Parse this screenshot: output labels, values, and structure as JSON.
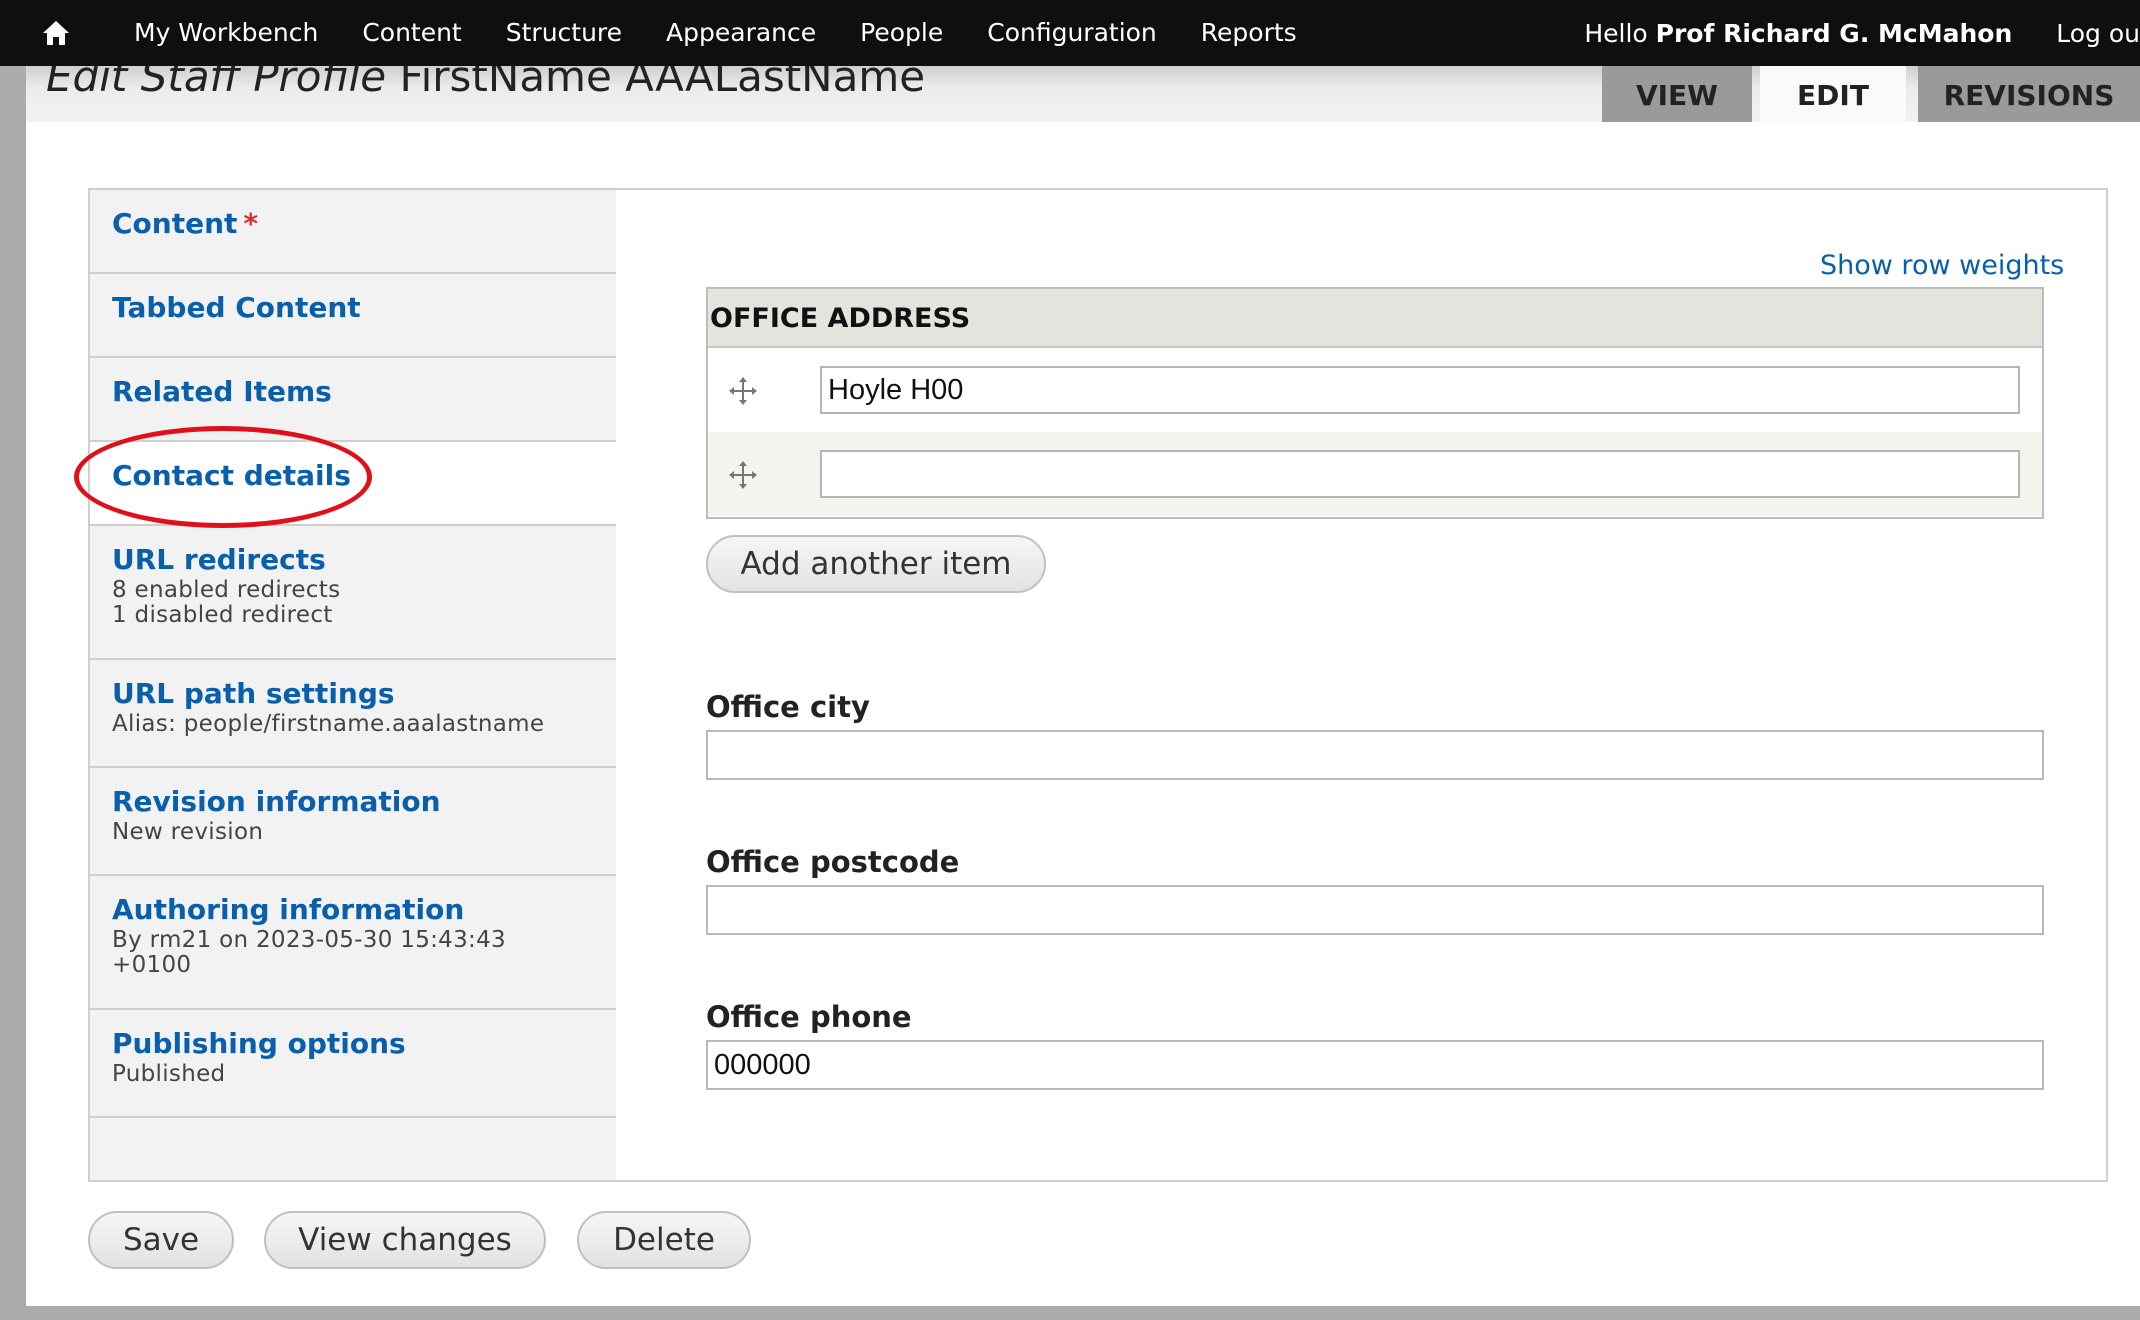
{
  "toolbar": {
    "home_icon": "home-icon",
    "items": [
      "My Workbench",
      "Content",
      "Structure",
      "Appearance",
      "People",
      "Configuration",
      "Reports"
    ],
    "hello_prefix": "Hello ",
    "user_name": "Prof Richard G. McMahon",
    "logout": "Log ou"
  },
  "page": {
    "title_type": "Edit Staff Profile",
    "title_name": "FirstName AAALastName"
  },
  "tabs": {
    "view": "VIEW",
    "edit": "EDIT",
    "revisions": "REVISIONS"
  },
  "vertical_tabs": [
    {
      "title": "Content",
      "required_mark": "*"
    },
    {
      "title": "Tabbed Content"
    },
    {
      "title": "Related Items"
    },
    {
      "title": "Contact details"
    },
    {
      "title": "URL redirects",
      "sub": [
        "8 enabled redirects",
        "1 disabled redirect"
      ]
    },
    {
      "title": "URL path settings",
      "sub": [
        "Alias: people/firstname.aaalastname"
      ]
    },
    {
      "title": "Revision information",
      "sub": [
        "New revision"
      ]
    },
    {
      "title": "Authoring information",
      "sub": [
        "By rm21 on 2023-05-30 15:43:43",
        "+0100"
      ]
    },
    {
      "title": "Publishing options",
      "sub": [
        "Published"
      ]
    }
  ],
  "office_address": {
    "show_row_weights": "Show row weights",
    "header": "OFFICE ADDRESS",
    "rows": [
      "Hoyle H00",
      ""
    ],
    "add_another": "Add another item"
  },
  "fields": {
    "city": {
      "label": "Office city",
      "value": ""
    },
    "postcode": {
      "label": "Office postcode",
      "value": ""
    },
    "phone": {
      "label": "Office phone",
      "value": "000000"
    }
  },
  "actions": {
    "save": "Save",
    "view_changes": "View changes",
    "delete": "Delete"
  },
  "colors": {
    "link": "#0a5fab",
    "required": "#d32f2f",
    "highlight": "#e0101a"
  }
}
